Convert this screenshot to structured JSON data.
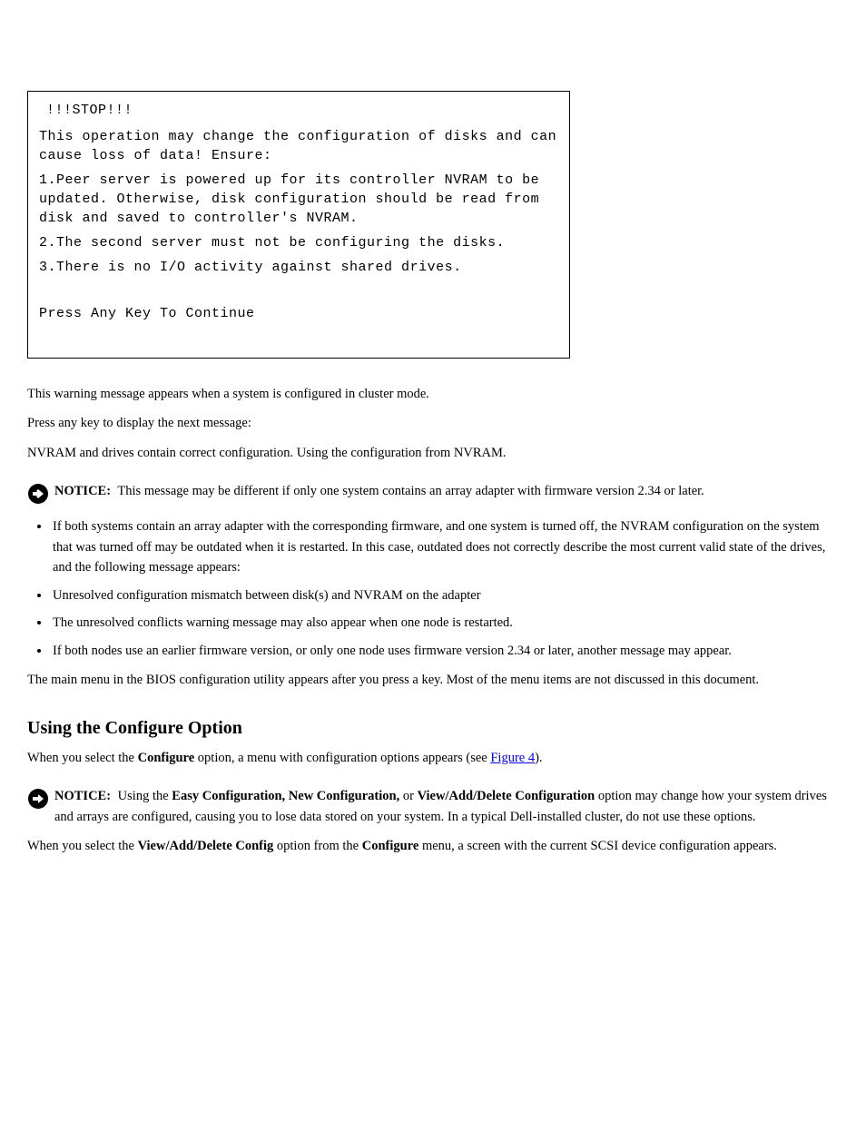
{
  "console": {
    "header": "!!!STOP!!!",
    "para1": "This operation may change the configuration of disks and can cause loss of data! Ensure:",
    "item1": "1.Peer server is powered up for its controller NVRAM to be updated. Otherwise, disk configuration should be read from disk and saved to controller's NVRAM.",
    "item2": "2.The second server must not be configuring the disks.",
    "item3": "3.There is no I/O activity against shared drives.",
    "continue": "Press Any Key To Continue"
  },
  "body": {
    "p_warning_intro": "This warning message appears when a system is configured in cluster mode.",
    "p_press": "Press any key to display the next message:",
    "p_raid_msg": "NVRAM and drives contain correct configuration. Using the configuration from NVRAM.",
    "notice1_label": "NOTICE:",
    "notice1_text": "This message may be different if only one system contains an array adapter with firmware version 2.34 or later.",
    "bullets": [
      "If both systems contain an array adapter with the corresponding firmware, and one system is turned off, the NVRAM configuration on the system that was turned off may be outdated when it is restarted. In this case, outdated does not correctly describe the most current valid state of the drives, and the following message appears:",
      "Unresolved configuration mismatch between disk(s) and NVRAM on the adapter",
      "The unresolved conflicts warning message may also appear when one node is restarted.",
      "If both nodes use an earlier firmware version, or only one node uses firmware version 2.34 or later, another message may appear."
    ],
    "p_after_bullets": "The main menu in the BIOS configuration utility appears after you press a key. Most of the menu items are not discussed in this document.",
    "subheading": "Using the Configure Option",
    "p_configure_intro_a": "When you select the ",
    "p_configure_bold": "Configure",
    "p_configure_intro_b": " option, a menu with configuration options appears (see ",
    "p_configure_link": "Figure 4",
    "p_configure_intro_c": ").",
    "notice2_label": "NOTICE:",
    "notice2_text_a": "Using the ",
    "notice2_bold1": "Easy Configuration, New Configuration,",
    "notice2_text_b": " or ",
    "notice2_bold2": "View/Add/Delete Configuration",
    "notice2_text_c": " option may change how your system drives and arrays are configured, causing you to lose data stored on your system. In a typical Dell-installed cluster, do not use these options.",
    "p_after_notice2_a": "When you select the ",
    "p_after_notice2_bold1": "View/Add/Delete Config",
    "p_after_notice2_b": " option from the ",
    "p_after_notice2_bold2": "Configure",
    "p_after_notice2_c": " menu, a screen with the current SCSI device configuration appears."
  }
}
